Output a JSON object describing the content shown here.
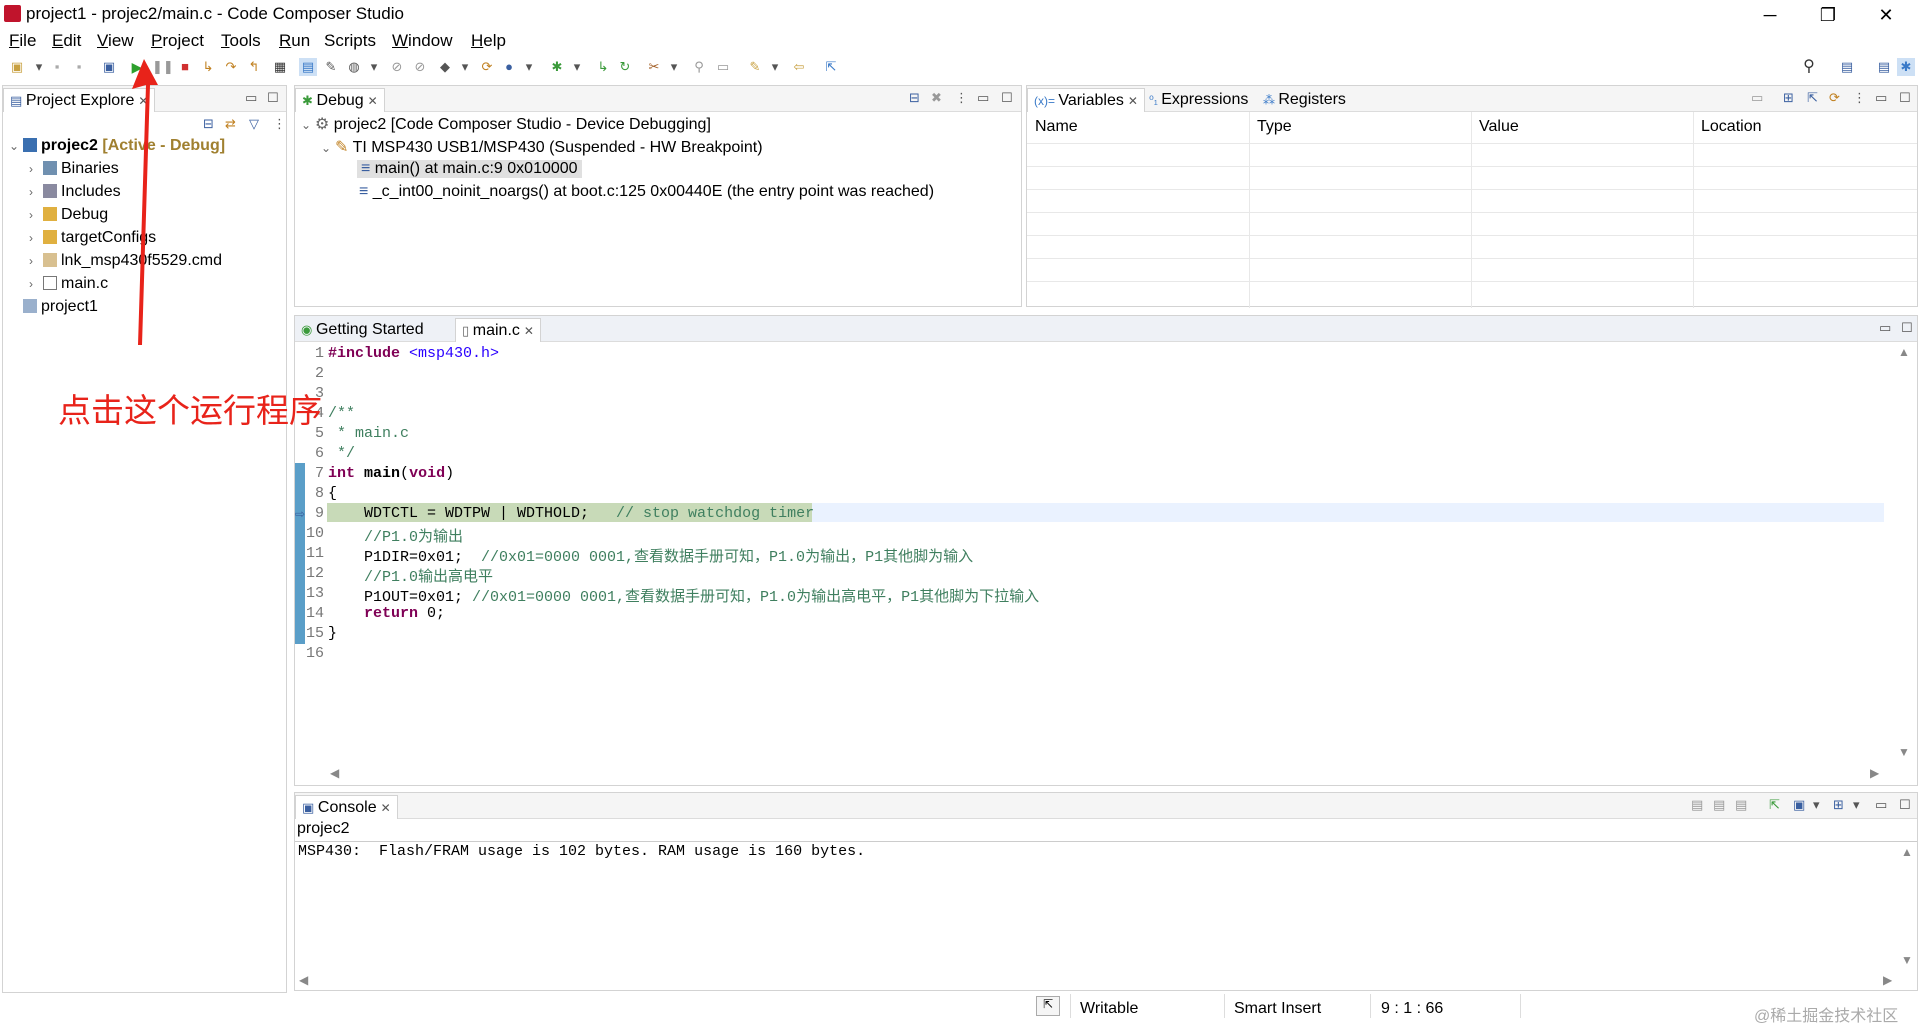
{
  "window": {
    "title": "project1 - projec2/main.c - Code Composer Studio"
  },
  "menu": [
    {
      "label": "File",
      "u": "F",
      "rest": "ile"
    },
    {
      "label": "Edit",
      "u": "E",
      "rest": "dit"
    },
    {
      "label": "View",
      "u": "V",
      "rest": "iew"
    },
    {
      "label": "Project",
      "u": "P",
      "rest": "roject"
    },
    {
      "label": "Tools",
      "u": "T",
      "rest": "ools"
    },
    {
      "label": "Run",
      "u": "R",
      "rest": "un"
    },
    {
      "label": "Scripts",
      "u": "",
      "rest": "Scripts"
    },
    {
      "label": "Window",
      "u": "W",
      "rest": "indow"
    },
    {
      "label": "Help",
      "u": "H",
      "rest": "elp"
    }
  ],
  "project_explorer": {
    "tab": "Project Explore",
    "items": [
      {
        "label": "projec2",
        "status": "[Active - Debug]"
      },
      {
        "label": "Binaries"
      },
      {
        "label": "Includes"
      },
      {
        "label": "Debug"
      },
      {
        "label": "targetConfigs"
      },
      {
        "label": "lnk_msp430f5529.cmd"
      },
      {
        "label": "main.c"
      },
      {
        "label": "project1"
      }
    ]
  },
  "debug": {
    "tab": "Debug",
    "items": [
      "projec2 [Code Composer Studio - Device Debugging]",
      "TI MSP430 USB1/MSP430 (Suspended - HW Breakpoint)",
      "main() at main.c:9 0x010000",
      "_c_int00_noinit_noargs() at boot.c:125 0x00440E  (the entry point was reached)"
    ]
  },
  "variables": {
    "tabs": [
      "Variables",
      "Expressions",
      "Registers"
    ],
    "columns": [
      "Name",
      "Type",
      "Value",
      "Location"
    ]
  },
  "editor": {
    "tabs": [
      "Getting Started",
      "main.c"
    ],
    "lines": [
      "1",
      "2",
      "3",
      "4",
      "5",
      "6",
      "7",
      "8",
      "9",
      "10",
      "11",
      "12",
      "13",
      "14",
      "15",
      "16"
    ]
  },
  "console": {
    "tab": "Console",
    "name": "projec2",
    "output": "MSP430:  Flash/FRAM usage is 102 bytes. RAM usage is 160 bytes."
  },
  "status": {
    "writable": "Writable",
    "insert": "Smart Insert",
    "position": "9 : 1 : 66"
  },
  "annotation": {
    "text": "点击这个运行程序",
    "color": "#e8231a"
  },
  "watermark": "@稀土掘金技术社区"
}
